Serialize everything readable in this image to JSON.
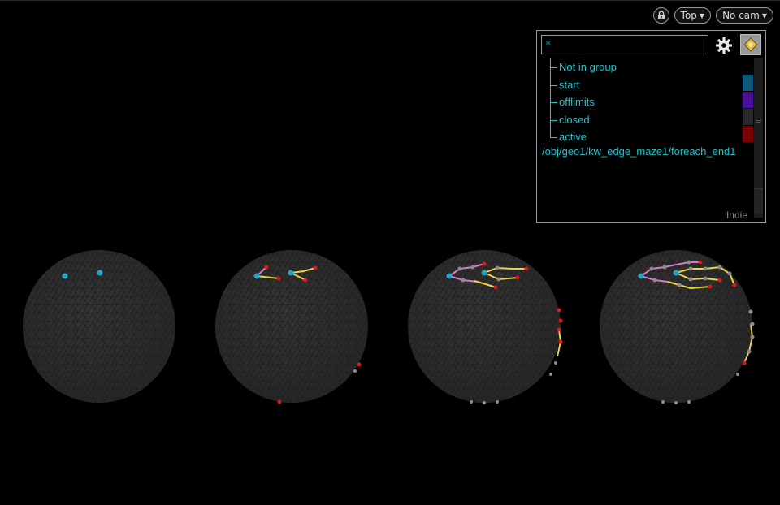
{
  "toolbar": {
    "view_label": "Top",
    "camera_label": "No cam",
    "lock_icon": "lock-icon"
  },
  "group_panel": {
    "filter_value": "*",
    "settings_icon": "gear-icon",
    "display_icon": "diamond-icon",
    "groups": [
      {
        "label": "Not in group",
        "color": "#000000"
      },
      {
        "label": "start",
        "color": "#0d5a7c"
      },
      {
        "label": "offlimits",
        "color": "#4a0f98"
      },
      {
        "label": "closed",
        "color": "#2a2a2a"
      },
      {
        "label": "active",
        "color": "#7a0404"
      }
    ],
    "node_path": "/obj/geo1/kw_edge_maze1/foreach_end1",
    "license_label": "Indie"
  },
  "colors": {
    "start_point": "#21a9cc",
    "active_point": "#e01818",
    "closed_point": "#8c8c8c",
    "edge_yellow": "#e8d54a",
    "edge_pink": "#d67ac8",
    "sphere_fill": "#2f2f2f",
    "sphere_wire": "#222222"
  }
}
